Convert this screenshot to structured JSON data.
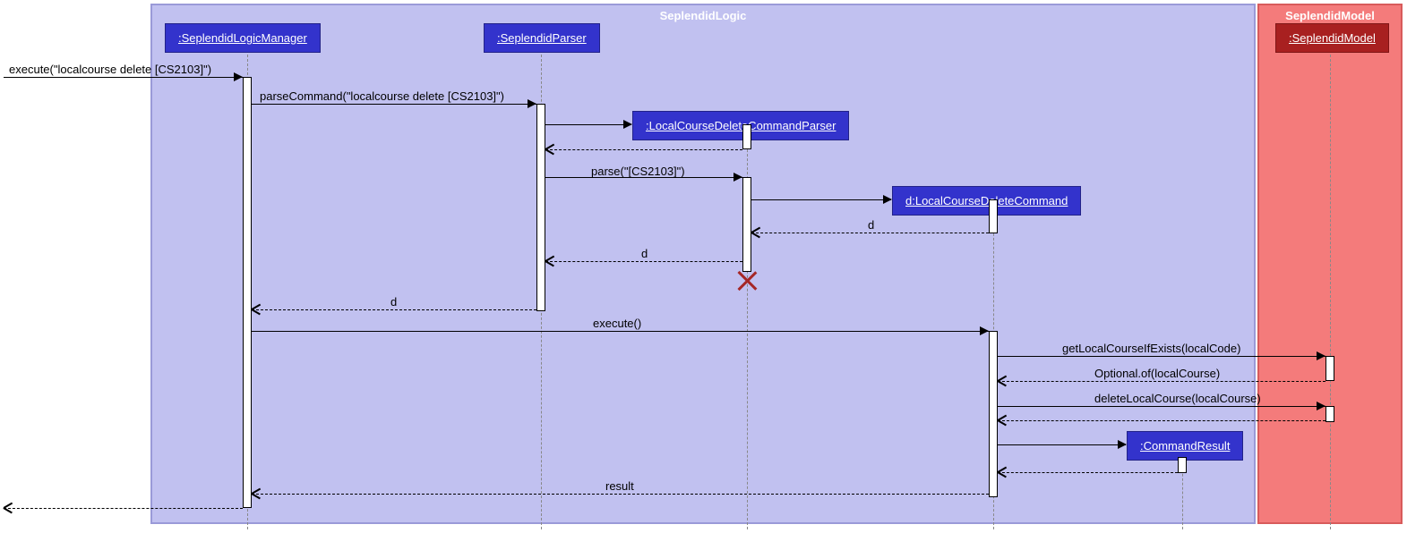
{
  "boxes": {
    "logic": {
      "title": "SeplendidLogic",
      "color": "#c1c1f0",
      "border": "#9a9ad8"
    },
    "model": {
      "title": "SeplendidModel",
      "color": "#f47b7b",
      "border": "#d85b5b"
    }
  },
  "participants": {
    "logicManager": ":SeplendidLogicManager",
    "parser": ":SeplendidParser",
    "deleteParser": ":LocalCourseDeleteCommandParser",
    "deleteCmd": "d:LocalCourseDeleteCommand",
    "model": ":SeplendidModel",
    "cmdResult": ":CommandResult"
  },
  "messages": {
    "m1": "execute(\"localcourse delete [CS2103]\")",
    "m2": "parseCommand(\"localcourse delete [CS2103]\")",
    "m3": "parse(\"[CS2103]\")",
    "m4": "d",
    "m5": "d",
    "m6": "d",
    "m7": "execute()",
    "m8": "getLocalCourseIfExists(localCode)",
    "m9": "Optional.of(localCourse)",
    "m10": "deleteLocalCourse(localCourse)",
    "m11": "result"
  }
}
